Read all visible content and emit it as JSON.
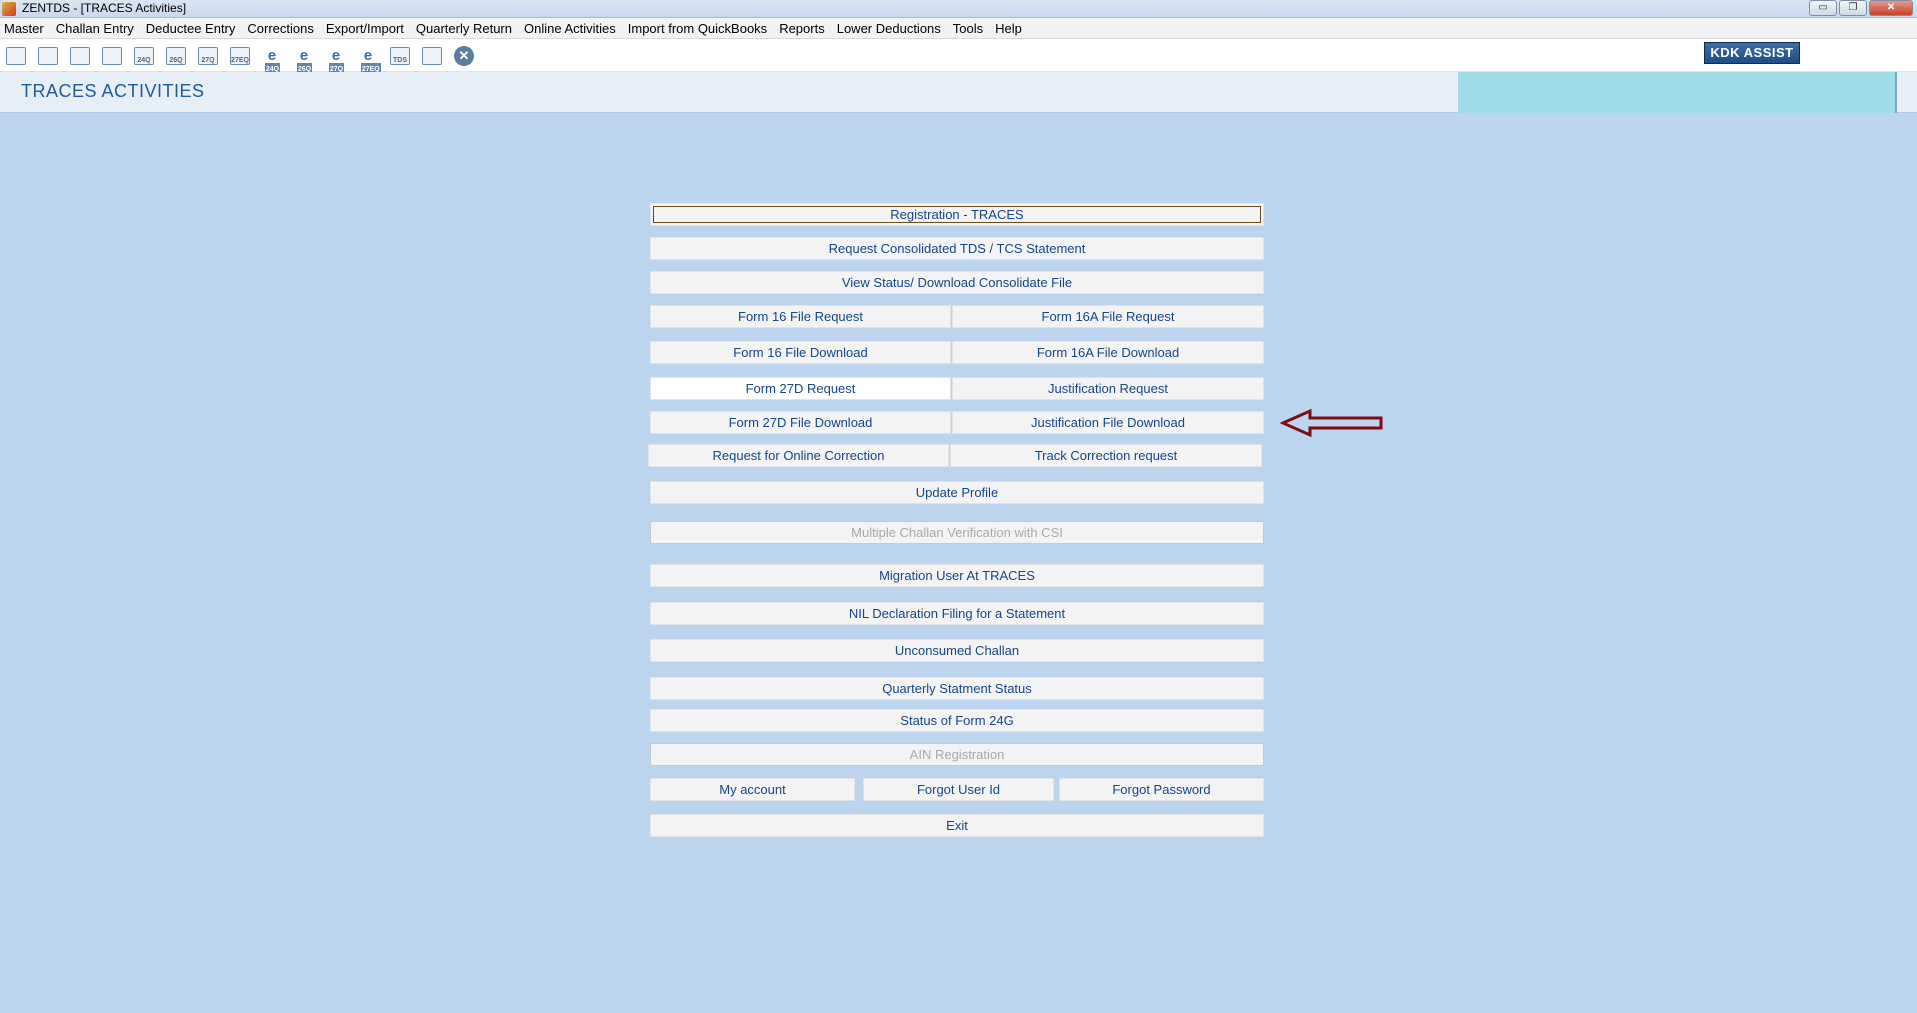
{
  "window": {
    "title": "ZENTDS - [TRACES Activities]",
    "controls": {
      "minimize": "▭",
      "restore": "❐",
      "close": "✕"
    }
  },
  "menu": [
    "Master",
    "Challan Entry",
    "Deductee Entry",
    "Corrections",
    "Export/Import",
    "Quarterly Return",
    "Online Activities",
    "Import from QuickBooks",
    "Reports",
    "Lower Deductions",
    "Tools",
    "Help"
  ],
  "toolbar": {
    "icons": [
      {
        "name": "deductor-icon",
        "kind": "glyph",
        "label": ""
      },
      {
        "name": "deductees-icon",
        "kind": "glyph",
        "label": ""
      },
      {
        "name": "form-icon",
        "kind": "glyph",
        "label": ""
      },
      {
        "name": "form-2-icon",
        "kind": "glyph",
        "label": ""
      },
      {
        "name": "form-24q-icon",
        "kind": "glyph",
        "label": "24Q"
      },
      {
        "name": "form-26q-icon",
        "kind": "glyph",
        "label": "26Q"
      },
      {
        "name": "form-27q-icon",
        "kind": "glyph",
        "label": "27Q"
      },
      {
        "name": "form-27eq-icon",
        "kind": "glyph",
        "label": "27EQ"
      },
      {
        "name": "e-24q-icon",
        "kind": "e",
        "label": "24Q"
      },
      {
        "name": "e-26q-icon",
        "kind": "e",
        "label": "26Q"
      },
      {
        "name": "e-27q-icon",
        "kind": "e",
        "label": "27Q"
      },
      {
        "name": "e-27eq-icon",
        "kind": "e",
        "label": "27EQ"
      },
      {
        "name": "tds-icon",
        "kind": "glyph",
        "label": "TDS"
      },
      {
        "name": "report-icon",
        "kind": "glyph",
        "label": ""
      },
      {
        "name": "close-circle-icon",
        "kind": "x",
        "label": "✕"
      }
    ],
    "kdk_assist": "KDK ASSIST"
  },
  "header": {
    "title": "TRACES ACTIVITIES"
  },
  "buttons": {
    "registration": "Registration - TRACES",
    "request_consolidated": "Request Consolidated TDS / TCS Statement",
    "view_status": "View Status/ Download Consolidate File",
    "form16_request": "Form 16 File Request",
    "form16a_request": "Form 16A File Request",
    "form16_download": "Form 16 File Download",
    "form16a_download": "Form 16A File Download",
    "form27d_request": "Form 27D Request",
    "justification_request": "Justification Request",
    "form27d_download": "Form 27D File Download",
    "justification_download": "Justification File Download",
    "online_correction": "Request for Online Correction",
    "track_correction": "Track Correction request",
    "update_profile": "Update Profile",
    "multiple_challan": "Multiple Challan Verification with CSI",
    "migration_user": "Migration User At TRACES",
    "nil_declaration": "NIL Declaration Filing for a Statement",
    "unconsumed_challan": "Unconsumed Challan",
    "quarterly_status": "Quarterly Statment Status",
    "status_24g": "Status of Form 24G",
    "ain_registration": "AIN Registration",
    "my_account": "My account",
    "forgot_user_id": "Forgot User Id",
    "forgot_password": "Forgot Password",
    "exit": "Exit"
  },
  "colors": {
    "background": "#bdd4ee",
    "button_text": "#13468a",
    "arrow": "#7a0d12"
  }
}
